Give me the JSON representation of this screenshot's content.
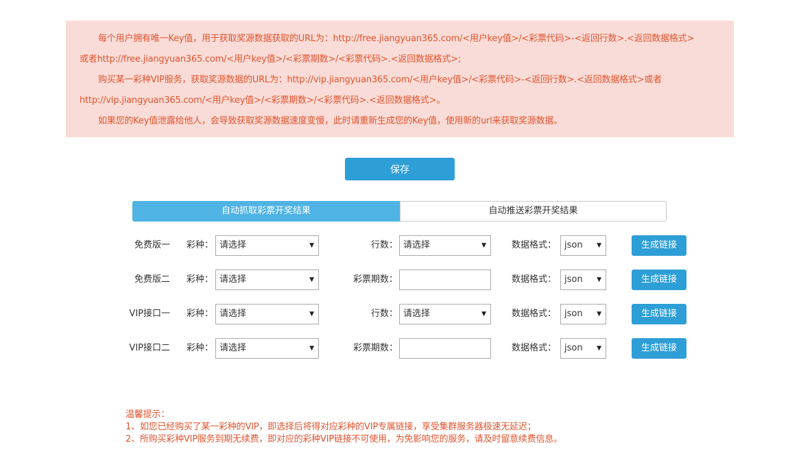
{
  "notice": {
    "line1": "每个用户拥有唯一Key值，用于获取奖源数据获取的URL为：http://free.jiangyuan365.com/<用户key值>/<彩票代码>-<返回行数>.<返回数据格式>",
    "line2": "或者http://free.jiangyuan365.com/<用户key值>/<彩票期数>/<彩票代码>.<返回数据格式>;",
    "line3": "购买某一彩种VIP服务，获取奖源数据的URL为：http://vip.jiangyuan365.com/<用户key值>/<彩票代码>-<返回行数>.<返回数据格式>或者",
    "line4": "http://vip.jiangyuan365.com/<用户key值>/<彩票期数>/<彩票代码>.<返回数据格式>。",
    "line5": "如果您的Key值泄露给他人，会导致获取奖源数据速度变慢，此时请重新生成您的Key值，使用新的url来获取奖源数据。"
  },
  "save_label": "保存",
  "tabs": [
    "自动抓取彩票开奖结果",
    "自动推送彩票开奖结果"
  ],
  "rows": [
    {
      "name": "免费版一",
      "type_label": "彩种：",
      "type_value": "请选择",
      "mid_label": "行数：",
      "mid_value": "请选择",
      "format_label": "数据格式：",
      "format_value": "json",
      "button": "生成链接"
    },
    {
      "name": "免费版二",
      "type_label": "彩种：",
      "type_value": "请选择",
      "mid_label": "彩票期数：",
      "mid_value": "",
      "format_label": "数据格式：",
      "format_value": "json",
      "button": "生成链接"
    },
    {
      "name": "VIP接口一",
      "type_label": "彩种：",
      "type_value": "请选择",
      "mid_label": "行数：",
      "mid_value": "请选择",
      "format_label": "数据格式：",
      "format_value": "json",
      "button": "生成链接"
    },
    {
      "name": "VIP接口二",
      "type_label": "彩种：",
      "type_value": "请选择",
      "mid_label": "彩票期数：",
      "mid_value": "",
      "format_label": "数据格式：",
      "format_value": "json",
      "button": "生成链接"
    }
  ],
  "tips": {
    "title": "温馨提示：",
    "line1": "1、如您已经购买了某一彩种的VIP，即选择后将得对应彩种的VIP专属链接，享受集群服务器极速无延迟；",
    "line2": "2、所购买彩种VIP服务到期无续费，即对应的彩种VIP链接不可使用，为免影响您的服务，请及时留意续费信息。"
  },
  "colors": {
    "accent": "#2e9ed6",
    "tab_active": "#4fb3e3",
    "notice_bg": "#f9dcd7",
    "notice_text": "#e0542f"
  }
}
